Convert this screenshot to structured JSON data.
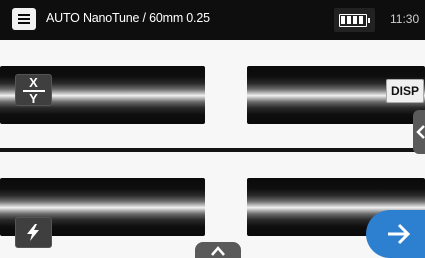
{
  "header": {
    "title": "AUTO NanoTune / 60mm 0.25",
    "time": "11:30"
  },
  "icons": {
    "menu": "hamburger-menu-icon",
    "battery": "battery-full-icon",
    "xy_toggle": "xy-swap-icon",
    "arc": "lightning-bolt-icon",
    "next": "arrow-right-icon",
    "side_panel": "chevron-left-icon",
    "bottom_panel": "chevron-up-icon"
  },
  "buttons": {
    "xy_top": "X",
    "xy_bottom": "Y",
    "display": "DISP"
  },
  "colors": {
    "top_bar": "#0e0e0e",
    "next_button": "#2d7fcf",
    "panel_tab": "#5a5a5a"
  }
}
